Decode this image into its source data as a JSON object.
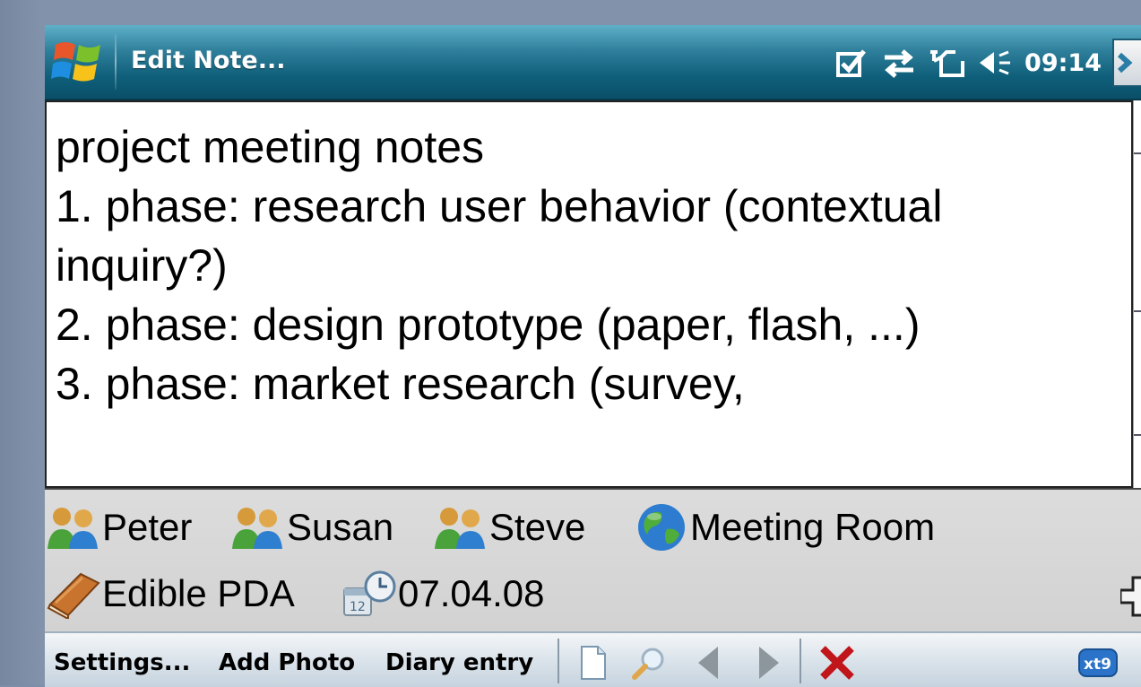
{
  "window": {
    "title": "Edit Note...",
    "clock": "09:14"
  },
  "note": {
    "lines": [
      "project meeting notes",
      "1. phase: research user behavior (contextual",
      "inquiry?)",
      "2. phase: design prototype (paper, flash, ...)",
      "3. phase: market research (survey,"
    ]
  },
  "tags": {
    "people": [
      "Peter",
      "Susan",
      "Steve"
    ],
    "location": "Meeting Room",
    "project": "Edible PDA",
    "date": "07.04.08"
  },
  "menu": {
    "settings": "Settings...",
    "add_photo": "Add Photo",
    "diary_entry": "Diary entry",
    "input_method": "xt9"
  },
  "icons": {
    "start": "windows-flag-icon",
    "status": [
      "checkbox-notification-icon",
      "connectivity-arrows-icon",
      "phone-signal-icon",
      "volume-icon"
    ],
    "toolbar": [
      "new-document-icon",
      "search-icon",
      "previous-arrow-icon",
      "next-arrow-icon",
      "delete-x-icon"
    ]
  },
  "colors": {
    "titlebar": "#1a6d8a",
    "delete": "#c0151a",
    "tag_panel": "#d6d6d6"
  }
}
